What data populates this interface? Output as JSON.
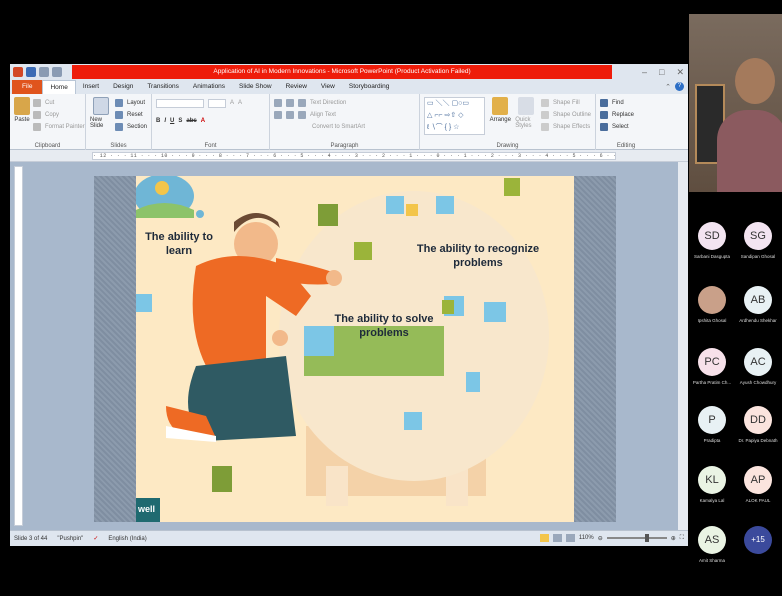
{
  "window": {
    "title": "Application of AI in Modern Innovations - Microsoft PowerPoint (Product Activation Failed)"
  },
  "tabs": [
    "File",
    "Home",
    "Insert",
    "Design",
    "Transitions",
    "Animations",
    "Slide Show",
    "Review",
    "View",
    "Storyboarding"
  ],
  "ribbon": {
    "clipboard": {
      "paste": "Paste",
      "cut": "Cut",
      "copy": "Copy",
      "format_painter": "Format Painter",
      "name": "Clipboard"
    },
    "slides": {
      "new_slide": "New Slide",
      "layout": "Layout",
      "reset": "Reset",
      "section": "Section",
      "name": "Slides"
    },
    "font": {
      "name": "Font"
    },
    "paragraph": {
      "text_direction": "Text Direction",
      "align_text": "Align Text",
      "convert_smartart": "Convert to SmartArt",
      "name": "Paragraph"
    },
    "drawing": {
      "arrange": "Arrange",
      "quick_styles": "Quick Styles",
      "shape_fill": "Shape Fill",
      "shape_outline": "Shape Outline",
      "shape_effects": "Shape Effects",
      "name": "Drawing"
    },
    "editing": {
      "find": "Find",
      "replace": "Replace",
      "select": "Select",
      "name": "Editing"
    }
  },
  "ruler_text": "· 12 · · · 11 · · · 10 · · · 9 · · · 8 · · · 7 · · · 6 · · · 5 · · · 4 · · · 3 · · · 2 · · · 1 · · · 0 · · · 1 · · · 2 · · · 3 · · · 4 · · · 5 · · · 6 · · · 7 · · · 8 · · · 9 · · · 10 · · · 11 · · · 12 ·",
  "slide": {
    "label_learn": "The ability to learn",
    "label_recognize": "The ability to recognize problems",
    "label_solve": "The ability to solve problems",
    "brand": "well"
  },
  "status": {
    "slide_info": "Slide 3 of 44",
    "theme": "\"Pushpin\"",
    "language": "English (India)",
    "zoom": "110%"
  },
  "participants": [
    {
      "initials": "SD",
      "name": "Sarbani Dasgupta",
      "color": "#f3e4f1"
    },
    {
      "initials": "SG",
      "name": "Sandipan Ghosal",
      "color": "#f3e4f1"
    },
    {
      "initials": "",
      "name": "Ipshita Ghosal",
      "color": "#c9a089"
    },
    {
      "initials": "AB",
      "name": "Ardhendu Shekhar",
      "color": "#e8f1f4"
    },
    {
      "initials": "PC",
      "name": "Partha Pratim Ch...",
      "color": "#f7e1ea"
    },
    {
      "initials": "AC",
      "name": "Ayush Chowdhury",
      "color": "#e8f1f4"
    },
    {
      "initials": "P",
      "name": "Pradipta",
      "color": "#e8f1f4"
    },
    {
      "initials": "DD",
      "name": "Dr. Papiya Debnath",
      "color": "#fbe4de"
    },
    {
      "initials": "KL",
      "name": "Kamalya Lal",
      "color": "#eaf4e4"
    },
    {
      "initials": "AP",
      "name": "ALOK PAUL",
      "color": "#fbe4de"
    },
    {
      "initials": "AS",
      "name": "Amit Sharma",
      "color": "#eaf4e4"
    },
    {
      "initials": "+15",
      "name": "",
      "color": "#3b4a9c"
    }
  ]
}
